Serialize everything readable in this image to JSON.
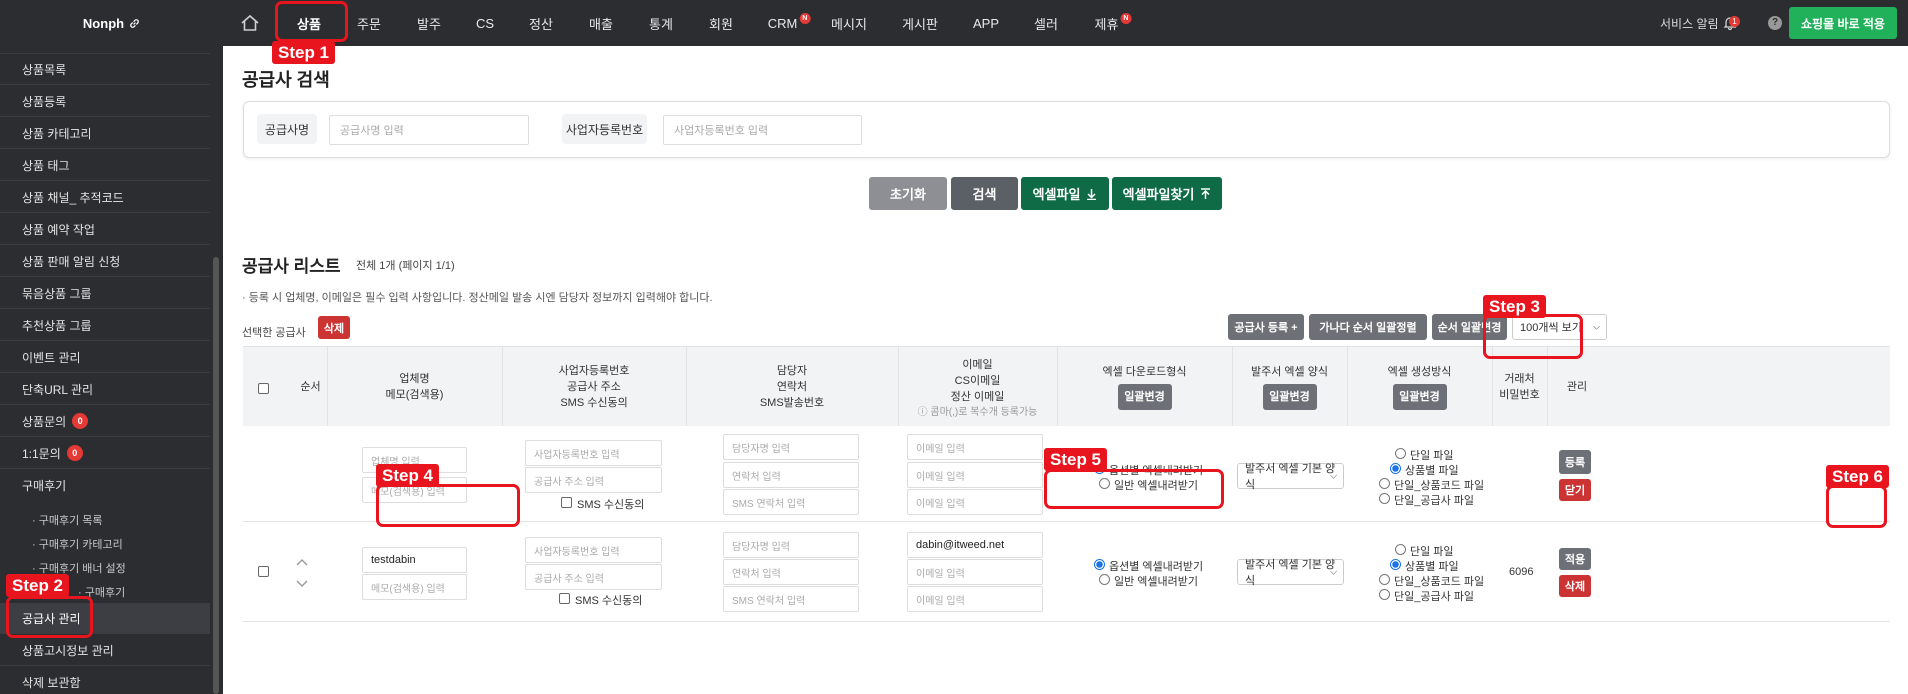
{
  "topbar": {
    "logo": "Nonph",
    "nav": [
      {
        "label": "상품",
        "active": true
      },
      {
        "label": "주문"
      },
      {
        "label": "발주"
      },
      {
        "label": "CS"
      },
      {
        "label": "정산"
      },
      {
        "label": "매출"
      },
      {
        "label": "통계"
      },
      {
        "label": "회원"
      },
      {
        "label": "CRM",
        "badge": "N"
      },
      {
        "label": "메시지"
      },
      {
        "label": "게시판"
      },
      {
        "label": "APP"
      },
      {
        "label": "셀러"
      },
      {
        "label": "제휴",
        "badge": "N"
      }
    ],
    "service_alert": "서비스 알림",
    "alert_count": "1",
    "help": "?",
    "apply_button": "쇼핑몰 바로 적용"
  },
  "sidebar": {
    "items": [
      {
        "label": "상품목록"
      },
      {
        "label": "상품등록"
      },
      {
        "label": "상품 카테고리"
      },
      {
        "label": "상품 태그"
      },
      {
        "label": "상품 채널_ 추적코드"
      },
      {
        "label": "상품 예약 작업"
      },
      {
        "label": "상품 판매 알림 신청"
      },
      {
        "label": "묶음상품 그룹"
      },
      {
        "label": "추천상품 그룹"
      },
      {
        "label": "이벤트 관리"
      },
      {
        "label": "단축URL 관리"
      },
      {
        "label": "상품문의",
        "badge": "0"
      },
      {
        "label": "1:1문의",
        "badge": "0"
      }
    ],
    "review_group": "구매후기",
    "review_subs": [
      "· 구매후기 목록",
      "· 구매후기 카테고리",
      "· 구매후기 배너 설정",
      "· 구매후기"
    ],
    "supplier": "공급사 관리",
    "notice_info": "상품고시정보 관리",
    "trash": "삭제 보관함"
  },
  "search": {
    "title": "공급사 검색",
    "name_label": "공급사명",
    "name_placeholder": "공급사명 입력",
    "biz_label": "사업자등록번호",
    "biz_placeholder": "사업자등록번호 입력",
    "reset": "초기화",
    "search": "검색",
    "excel": "엑셀파일",
    "excel_find": "엑셀파일찾기"
  },
  "list": {
    "title": "공급사 리스트",
    "count": "전체 1개 (페이지 1/1)",
    "note": "· 등록 시 업체명, 이메일은 필수 입력 사항입니다. 정산메일 발송 시엔 담당자 정보까지 입력해야 합니다.",
    "selected_label": "선택한 공급사",
    "delete": "삭제",
    "register": "공급사 등록 +",
    "sort_alpha": "가나다 순서 일괄정렬",
    "sort_order": "순서 일괄변경",
    "per_page": "100개씩 보기"
  },
  "table": {
    "headers": {
      "order": "순서",
      "name": [
        "업체명",
        "메모(검색용)"
      ],
      "biz": [
        "사업자등록번호",
        "공급사 주소",
        "SMS 수신동의"
      ],
      "manager": [
        "담당자",
        "연락처",
        "SMS발송번호"
      ],
      "email": [
        "이메일",
        "CS이메일",
        "정산 이메일"
      ],
      "email_hint": "ⓘ 콤마(,)로 복수개 등록가능",
      "excel_dl": "엑셀 다운로드형식",
      "order_excel": "발주서 엑셀 양식",
      "excel_gen": "엑셀 생성방식",
      "password": [
        "거래처",
        "비밀번호"
      ],
      "manage": "관리",
      "bulk_change": "일괄변경"
    },
    "new_row": {
      "name_ph": "업체명 입력",
      "memo_ph": "메모(검색용) 입력",
      "biz_ph": "사업자등록번호 입력",
      "addr_ph": "공급사 주소 입력",
      "sms_agree": "SMS 수신동의",
      "mgr_ph": "담당자명 입력",
      "contact_ph": "연락처 입력",
      "sms_ph": "SMS 연락처 입력",
      "email_ph": "이메일 입력",
      "dl_opt1": "옵션별 엑셀내려받기",
      "dl_opt2": "일반 엑셀내려받기",
      "order_form": "발주서 엑셀 기본 양식",
      "gen_opt1": "단일 파일",
      "gen_opt2": "상품별 파일",
      "gen_opt3": "단일_상품코드 파일",
      "gen_opt4": "단일_공급사 파일",
      "register": "등록",
      "close": "닫기"
    },
    "row1": {
      "name": "testdabin",
      "email": "dabin@itweed.net",
      "password": "6096",
      "apply": "적용",
      "delete": "삭제"
    }
  },
  "steps": [
    "Step 1",
    "Step 2",
    "Step 3",
    "Step 4",
    "Step 5",
    "Step 6"
  ],
  "colors": {
    "step": "#e8141e",
    "green": "#21b15a",
    "dark_green": "#0f6b45",
    "topbar": "#2b2d31"
  }
}
